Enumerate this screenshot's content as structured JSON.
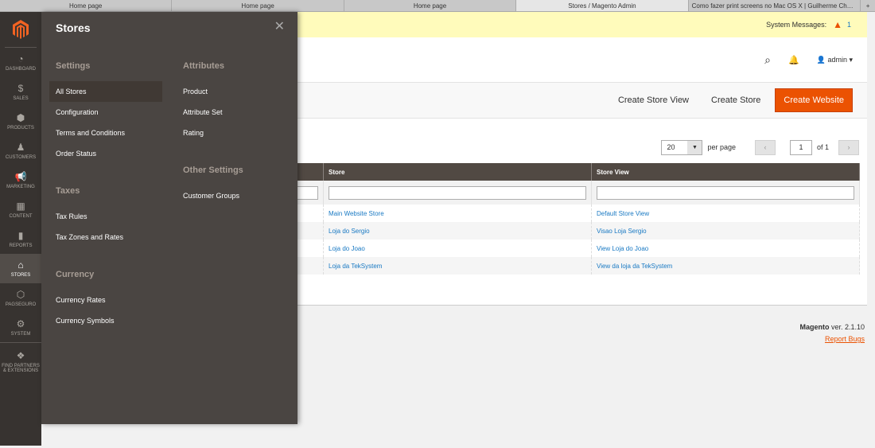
{
  "browser_tabs": [
    {
      "label": "Home page"
    },
    {
      "label": "Home page"
    },
    {
      "label": "Home page"
    },
    {
      "label": "Stores / Magento Admin",
      "active": true
    },
    {
      "label": "Como fazer print screens no Mac OS X | Guilherme Chaple..."
    }
  ],
  "new_tab": "+",
  "nav": [
    {
      "label": "Dashboard",
      "icon": "◔"
    },
    {
      "label": "Sales",
      "icon": "$"
    },
    {
      "label": "Products",
      "icon": "⬢"
    },
    {
      "label": "Customers",
      "icon": "♟"
    },
    {
      "label": "Marketing",
      "icon": "📢"
    },
    {
      "label": "Content",
      "icon": "▦"
    },
    {
      "label": "Reports",
      "icon": "▮"
    },
    {
      "label": "Stores",
      "icon": "⌂",
      "active": true
    },
    {
      "label": "PagSeguro",
      "icon": "⬡"
    },
    {
      "label": "System",
      "icon": "⚙"
    },
    {
      "label": "Find Partners & Extensions",
      "icon": "❖"
    }
  ],
  "system_messages": {
    "label": "System Messages:",
    "count": "1"
  },
  "header": {
    "user": "admin"
  },
  "actions": {
    "create_store_view": "Create Store View",
    "create_store": "Create Store",
    "create_website": "Create Website"
  },
  "pager": {
    "per_page_value": "20",
    "per_page_label": "per page",
    "page": "1",
    "of": "of 1"
  },
  "grid": {
    "columns": [
      "",
      "Store",
      "Store View"
    ],
    "rows": [
      [
        "",
        "Main Website Store",
        "Default Store View"
      ],
      [
        "",
        "Loja do Sergio",
        "Visao Loja Sergio"
      ],
      [
        "",
        "Loja do Joao",
        "View Loja do Joao"
      ],
      [
        "",
        "Loja da TekSystem",
        "View da loja da TekSystem"
      ]
    ]
  },
  "footer": {
    "brand": "Magento",
    "version": " ver. 2.1.10",
    "report_bugs": "Report Bugs"
  },
  "panel": {
    "title": "Stores",
    "groups_a": [
      {
        "title": "Settings",
        "items": [
          "All Stores",
          "Configuration",
          "Terms and Conditions",
          "Order Status"
        ]
      },
      {
        "title": "Taxes",
        "items": [
          "Tax Rules",
          "Tax Zones and Rates"
        ]
      },
      {
        "title": "Currency",
        "items": [
          "Currency Rates",
          "Currency Symbols"
        ]
      }
    ],
    "groups_b": [
      {
        "title": "Attributes",
        "items": [
          "Product",
          "Attribute Set",
          "Rating"
        ]
      },
      {
        "title": "Other Settings",
        "items": [
          "Customer Groups"
        ]
      }
    ]
  },
  "colors": {
    "accent": "#eb5202",
    "nav_bg": "#373330",
    "panel_bg": "#4a4542",
    "link": "#1979c3"
  }
}
